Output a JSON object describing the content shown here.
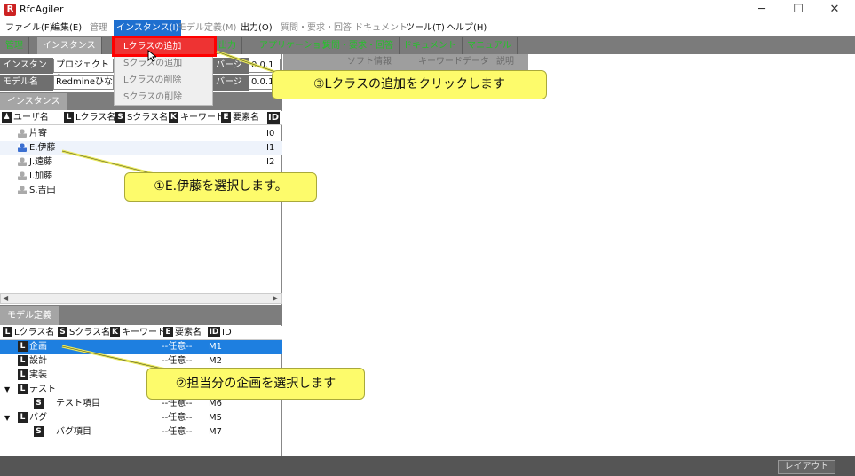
{
  "window": {
    "title": "RfcAgiler",
    "logo": "R",
    "minimize": "─",
    "maximize": "☐",
    "close": "✕"
  },
  "menubar": [
    {
      "label": "ファイル(F)",
      "disabled": false
    },
    {
      "label": "編集(E)",
      "disabled": false
    },
    {
      "label": "管理",
      "disabled": true
    },
    {
      "label": "インスタンス(I)",
      "disabled": false,
      "active": true
    },
    {
      "label": "モデル定義(M)",
      "disabled": true
    },
    {
      "label": "出力(O)",
      "disabled": false
    },
    {
      "label": "質問・要求・回答",
      "disabled": true
    },
    {
      "label": "ドキュメント",
      "disabled": true
    },
    {
      "label": "ツール(T)",
      "disabled": false
    },
    {
      "label": "ヘルプ(H)",
      "disabled": false
    }
  ],
  "tabs": [
    {
      "label": "管理"
    },
    {
      "label": "インスタンス"
    },
    {
      "label": "I"
    },
    {
      "label": "出力"
    },
    {
      "label": "アプリケーション"
    },
    {
      "label": "質問・要求・回答"
    },
    {
      "label": "ドキュメント"
    },
    {
      "label": "マニュアル"
    }
  ],
  "instance_fields": {
    "instance_label": "インスタンス名",
    "instance_value": "プロジェクトA",
    "model_label": "モデル名",
    "model_value": "Redmineひな型",
    "version_label": "バージョン",
    "version_value1": "0.0.1",
    "version_value2": "0.0.1"
  },
  "instance_section": {
    "title": "インスタンス",
    "columns": [
      "ユーザ名",
      "Lクラス名",
      "Sクラス名",
      "キーワード",
      "要素名",
      "ID"
    ],
    "rows": [
      {
        "user": "片寄",
        "id": "I0",
        "selected": false
      },
      {
        "user": "E.伊藤",
        "id": "I1",
        "selected": false,
        "highlight": true
      },
      {
        "user": "J.遠藤",
        "id": "I2",
        "selected": false
      },
      {
        "user": "I.加藤",
        "id": "",
        "selected": false
      },
      {
        "user": "S.吉田",
        "id": "",
        "selected": false
      }
    ]
  },
  "model_section": {
    "title": "モデル定義",
    "columns": [
      "Lクラス名",
      "Sクラス名",
      "キーワード",
      "要素名",
      "ID"
    ],
    "rows": [
      {
        "kind": "L",
        "name": "企画",
        "element": "--任意--",
        "id": "M1",
        "selected": true,
        "indent": 0,
        "expander": ""
      },
      {
        "kind": "L",
        "name": "設計",
        "element": "--任意--",
        "id": "M2",
        "selected": false,
        "indent": 0,
        "expander": ""
      },
      {
        "kind": "L",
        "name": "実装",
        "element": "",
        "id": "",
        "selected": false,
        "indent": 0,
        "expander": ""
      },
      {
        "kind": "L",
        "name": "テスト",
        "element": "",
        "id": "",
        "selected": false,
        "indent": 0,
        "expander": "▼"
      },
      {
        "kind": "S",
        "name": "テスト項目",
        "element": "--任意--",
        "id": "M6",
        "selected": false,
        "indent": 1,
        "expander": ""
      },
      {
        "kind": "L",
        "name": "バグ",
        "element": "--任意--",
        "id": "M5",
        "selected": false,
        "indent": 0,
        "expander": "▼"
      },
      {
        "kind": "S",
        "name": "バグ項目",
        "element": "--任意--",
        "id": "M7",
        "selected": false,
        "indent": 1,
        "expander": ""
      }
    ]
  },
  "right_tabs": [
    "",
    "ソフト情報",
    "キーワードデータ",
    "説明"
  ],
  "dropdown": [
    {
      "label": "Lクラスの追加",
      "highlighted": true
    },
    {
      "label": "Sクラスの追加",
      "highlighted": false
    },
    {
      "label": "Lクラスの削除",
      "highlighted": false
    },
    {
      "label": "Sクラスの削除",
      "highlighted": false
    }
  ],
  "callouts": {
    "step1": "①E.伊藤を選択します。",
    "step2": "②担当分の企画を選択します",
    "step3": "③Lクラスの追加をクリックします"
  },
  "statusbar": {
    "layout_button": "レイアウト"
  },
  "colors": {
    "accent": "#1e7fe0",
    "callout": "#fdfb6b",
    "tab_text": "#24c32a",
    "highlight_box": "#ff0000"
  }
}
